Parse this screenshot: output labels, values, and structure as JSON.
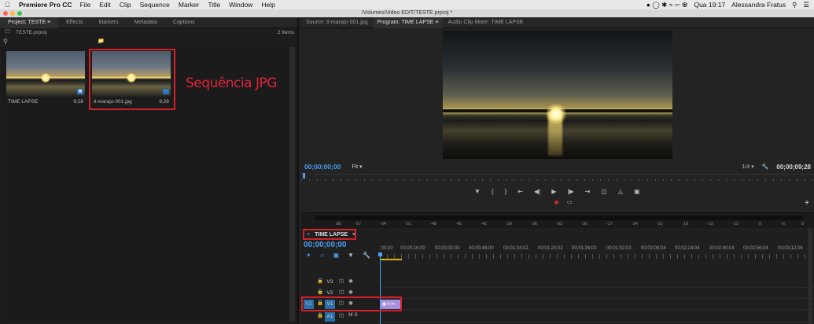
{
  "menubar": {
    "app_name": "Premiere Pro CC",
    "menus": [
      "File",
      "Edit",
      "Clip",
      "Sequence",
      "Marker",
      "Title",
      "Window",
      "Help"
    ],
    "clock": "Qua 19:17",
    "user": "Alessandra Fratus"
  },
  "window": {
    "title": "/Volumes/Video EDIT/TESTE.prproj *"
  },
  "project_panel": {
    "tabs": [
      "Project: TESTE",
      "Effects",
      "Markers",
      "Metadata",
      "Captions"
    ],
    "file": "TESTE.prproj",
    "item_count": "2 Items",
    "items": [
      {
        "name": "TIME LAPSE",
        "duration": "9;28"
      },
      {
        "name": "tl-marajo-001.jpg",
        "duration": "9;28"
      }
    ],
    "annotation": "Sequência JPG"
  },
  "program_monitor": {
    "tabs": [
      "Source: tl-marajo-001.jpg",
      "Program: TIME LAPSE",
      "Audio Clip Mixer: TIME LAPSE"
    ],
    "timecode_left": "00;00;00;00",
    "fit": "Fit",
    "resolution": "1/4",
    "timecode_right": "00;00;09;28"
  },
  "meter": {
    "labels": [
      "dB",
      "-57",
      "-54",
      "-51",
      "-48",
      "-45",
      "-42",
      "-39",
      "-36",
      "-33",
      "-30",
      "-27",
      "-24",
      "-21",
      "-18",
      "-15",
      "-12",
      "-9",
      "-6",
      "-3",
      "0"
    ]
  },
  "timeline": {
    "tab": "TIME LAPSE",
    "timecode": "00;00;00;00",
    "ruler": [
      ";00;00",
      "00;00;16;00",
      "00;00;32;00",
      "00;00;48;00",
      "00;01;04;02",
      "00;01;20;02",
      "00;01;36;02",
      "00;01;52;02",
      "00;02;08;04",
      "00;02;24;04",
      "00;02;40;04",
      "00;02;56;04",
      "00;03;12;06"
    ],
    "tracks": [
      {
        "label": "V3"
      },
      {
        "label": "V2"
      },
      {
        "label": "V1",
        "source": "V1",
        "clip": "tl-m"
      },
      {
        "label": "A1",
        "letters": "M  S"
      }
    ]
  },
  "colors": {
    "accent_blue": "#4a9ff5",
    "highlight_red": "#d62027",
    "clip_purple": "#a98ee0"
  }
}
